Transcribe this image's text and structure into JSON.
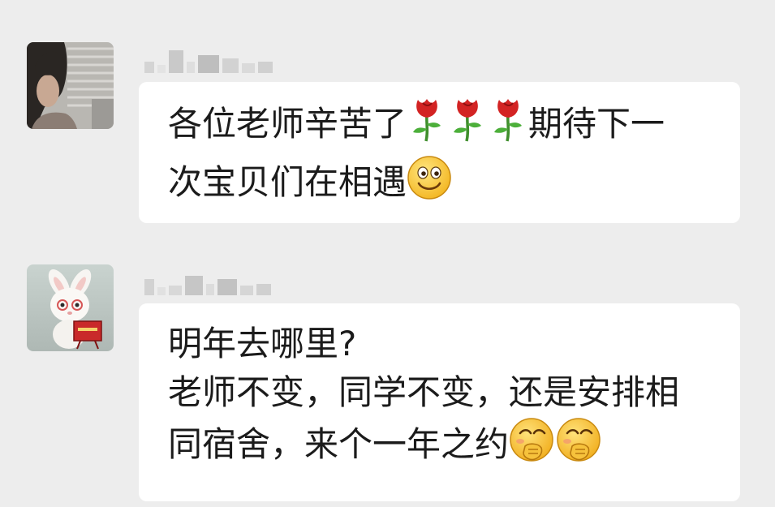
{
  "messages": [
    {
      "sender_name": "",
      "avatar_icon": "woman-photo-avatar",
      "text": {
        "line1_before": "各位老师辛苦了",
        "line1_icons": [
          "rose-emoji",
          "rose-emoji",
          "rose-emoji"
        ],
        "line1_after": "期待下一",
        "line2_before": "次宝贝们在相遇",
        "line2_icon": "smile-emoji"
      }
    },
    {
      "sender_name": "",
      "avatar_icon": "white-rabbit-avatar",
      "text": {
        "line1": "明年去哪里?",
        "line2": "老师不变，同学不变，还是安排相",
        "line3_before": "同宿舍，来个一年之约",
        "line3_icons": [
          "shy-giggle-emoji",
          "shy-giggle-emoji"
        ]
      }
    }
  ],
  "colors": {
    "background": "#EDEDED",
    "bubble": "#FFFFFF",
    "text": "#1B1B1B"
  }
}
